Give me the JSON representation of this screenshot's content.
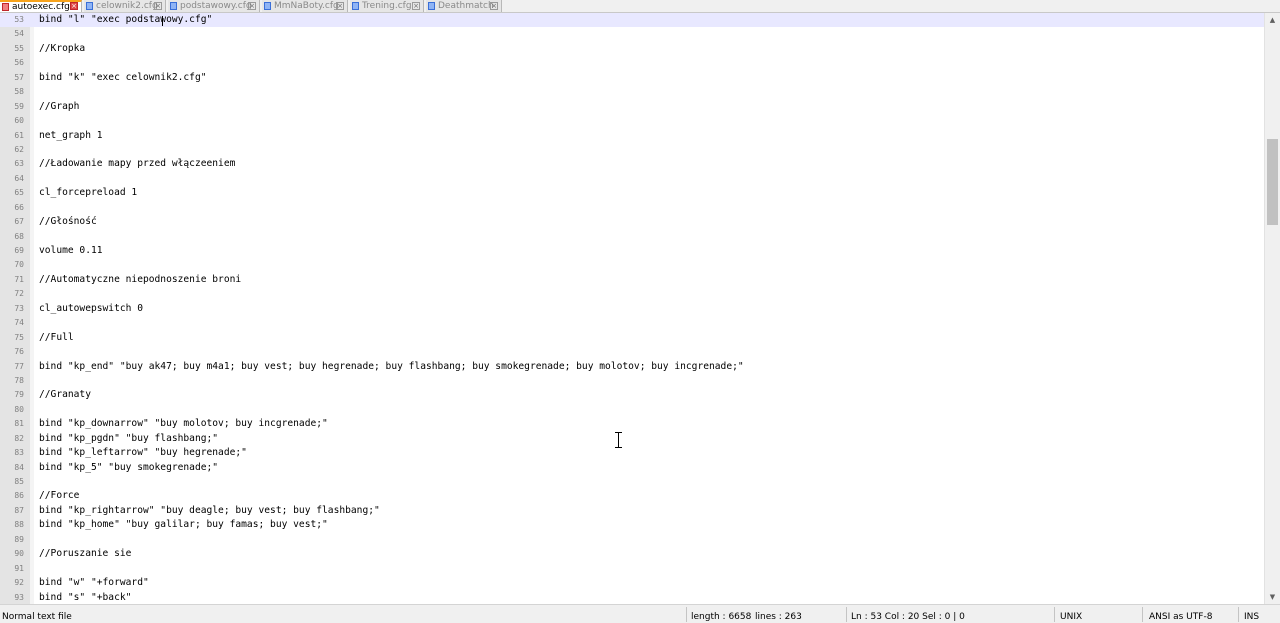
{
  "tabs": [
    {
      "label": "autoexec.cfg",
      "active": true
    },
    {
      "label": "celownik2.cfg",
      "active": false
    },
    {
      "label": "podstawowy.cfg",
      "active": false
    },
    {
      "label": "MmNaBoty.cfg",
      "active": false
    },
    {
      "label": "Trening.cfg",
      "active": false
    },
    {
      "label": "Deathmatch",
      "active": false
    }
  ],
  "editor": {
    "current_line": 53,
    "lines": [
      {
        "n": "53",
        "text": "bind \"l\" \"exec podstawowy.cfg\""
      },
      {
        "n": "54",
        "text": ""
      },
      {
        "n": "55",
        "text": "//Kropka"
      },
      {
        "n": "56",
        "text": ""
      },
      {
        "n": "57",
        "text": "bind \"k\" \"exec celownik2.cfg\""
      },
      {
        "n": "58",
        "text": ""
      },
      {
        "n": "59",
        "text": "//Graph"
      },
      {
        "n": "60",
        "text": ""
      },
      {
        "n": "61",
        "text": "net_graph 1"
      },
      {
        "n": "62",
        "text": ""
      },
      {
        "n": "63",
        "text": "//Ładowanie mapy przed włączeeniem"
      },
      {
        "n": "64",
        "text": ""
      },
      {
        "n": "65",
        "text": "cl_forcepreload 1"
      },
      {
        "n": "66",
        "text": ""
      },
      {
        "n": "67",
        "text": "//Głośność"
      },
      {
        "n": "68",
        "text": ""
      },
      {
        "n": "69",
        "text": "volume 0.11"
      },
      {
        "n": "70",
        "text": ""
      },
      {
        "n": "71",
        "text": "//Automatyczne niepodnoszenie broni"
      },
      {
        "n": "72",
        "text": ""
      },
      {
        "n": "73",
        "text": "cl_autowepswitch 0"
      },
      {
        "n": "74",
        "text": ""
      },
      {
        "n": "75",
        "text": "//Full"
      },
      {
        "n": "76",
        "text": ""
      },
      {
        "n": "77",
        "text": "bind \"kp_end\" \"buy ak47; buy m4a1; buy vest; buy hegrenade; buy flashbang; buy smokegrenade; buy molotov; buy incgrenade;\""
      },
      {
        "n": "78",
        "text": ""
      },
      {
        "n": "79",
        "text": "//Granaty"
      },
      {
        "n": "80",
        "text": ""
      },
      {
        "n": "81",
        "text": "bind \"kp_downarrow\" \"buy molotov; buy incgrenade;\""
      },
      {
        "n": "82",
        "text": "bind \"kp_pgdn\" \"buy flashbang;\""
      },
      {
        "n": "83",
        "text": "bind \"kp_leftarrow\" \"buy hegrenade;\""
      },
      {
        "n": "84",
        "text": "bind \"kp_5\" \"buy smokegrenade;\""
      },
      {
        "n": "85",
        "text": ""
      },
      {
        "n": "86",
        "text": "//Force"
      },
      {
        "n": "87",
        "text": "bind \"kp_rightarrow\" \"buy deagle; buy vest; buy flashbang;\""
      },
      {
        "n": "88",
        "text": "bind \"kp_home\" \"buy galilar; buy famas; buy vest;\""
      },
      {
        "n": "89",
        "text": ""
      },
      {
        "n": "90",
        "text": "//Poruszanie sie"
      },
      {
        "n": "91",
        "text": ""
      },
      {
        "n": "92",
        "text": "bind \"w\" \"+forward\""
      },
      {
        "n": "93",
        "text": "bind \"s\" \"+back\""
      }
    ]
  },
  "statusbar": {
    "file_type": "Normal text file",
    "length": "length : 6658",
    "lines": "lines : 263",
    "position": "Ln : 53   Col : 20   Sel : 0 | 0",
    "eol": "UNIX",
    "encoding": "ANSI as UTF-8",
    "mode": "INS"
  },
  "colors": {
    "current_line_bg": "#e8e8ff",
    "active_tab_accent": "#f7a31c",
    "gutter_bg": "#e4e4e4",
    "line_number": "#808080",
    "statusbar_bg": "#f0f0f0"
  },
  "icons": {
    "tab_file": "file-icon",
    "tab_close": "close-icon",
    "scroll_up": "chevron-up-icon",
    "scroll_down": "chevron-down-icon",
    "mouse_cursor": "text-cursor-icon"
  }
}
